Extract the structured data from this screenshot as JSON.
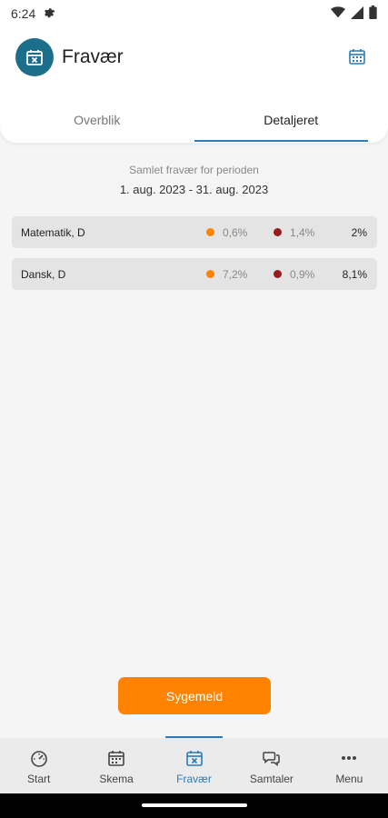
{
  "status_bar": {
    "time": "6:24",
    "icons": [
      "gear-icon",
      "wifi-icon",
      "signal-icon",
      "battery-icon"
    ]
  },
  "header": {
    "title": "Fravær",
    "avatar_icon": "calendar-x-icon",
    "action_icon": "calendar-icon",
    "accent_color": "#1b6f8a"
  },
  "tabs": [
    {
      "label": "Overblik",
      "active": false
    },
    {
      "label": "Detaljeret",
      "active": true
    }
  ],
  "period": {
    "label": "Samlet fravær for perioden",
    "range": "1. aug. 2023 - 31. aug. 2023"
  },
  "rows": [
    {
      "subject": "Matematik, D",
      "value_a": "0,6%",
      "value_b": "1,4%",
      "total": "2%"
    },
    {
      "subject": "Dansk, D",
      "value_a": "7,2%",
      "value_b": "0,9%",
      "total": "8,1%"
    }
  ],
  "legend_colors": {
    "orange": "#ff8200",
    "dark_red": "#9b1c1c"
  },
  "actions": {
    "sick_label": "Sygemeld",
    "sick_color": "#ff8200"
  },
  "bottom_nav": [
    {
      "label": "Start",
      "icon": "speedometer-icon",
      "active": false
    },
    {
      "label": "Skema",
      "icon": "calendar-icon",
      "active": false
    },
    {
      "label": "Fravær",
      "icon": "calendar-x-icon",
      "active": true
    },
    {
      "label": "Samtaler",
      "icon": "chat-bubbles-icon",
      "active": false
    },
    {
      "label": "Menu",
      "icon": "more-dots-icon",
      "active": false
    }
  ]
}
